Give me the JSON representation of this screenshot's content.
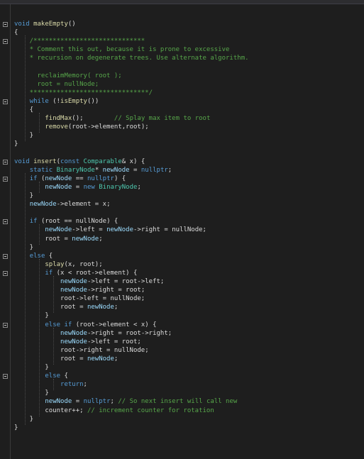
{
  "editor": {
    "lines": [
      [
        {
          "t": "void ",
          "c": "kw"
        },
        {
          "t": "makeEmpty",
          "c": "fn"
        },
        {
          "t": "()",
          "c": ""
        }
      ],
      [
        {
          "t": "{",
          "c": ""
        }
      ],
      [
        {
          "t": "    /*****************************",
          "c": "cm"
        }
      ],
      [
        {
          "t": "    * Comment this out, because it is prone to excessive",
          "c": "cm"
        }
      ],
      [
        {
          "t": "    * recursion on degenerate trees. Use alternate algorithm.",
          "c": "cm"
        }
      ],
      [
        {
          "t": "",
          "c": ""
        }
      ],
      [
        {
          "t": "      reclaimMemory( root );",
          "c": "cm"
        }
      ],
      [
        {
          "t": "      root = nullNode;",
          "c": "cm"
        }
      ],
      [
        {
          "t": "    *******************************/",
          "c": "cm"
        }
      ],
      [
        {
          "t": "    ",
          "c": ""
        },
        {
          "t": "while",
          "c": "kw"
        },
        {
          "t": " (!",
          "c": ""
        },
        {
          "t": "isEmpty",
          "c": "fn"
        },
        {
          "t": "())",
          "c": ""
        }
      ],
      [
        {
          "t": "    {",
          "c": ""
        }
      ],
      [
        {
          "t": "        ",
          "c": ""
        },
        {
          "t": "findMax",
          "c": "fn"
        },
        {
          "t": "();        ",
          "c": ""
        },
        {
          "t": "// Splay max item to root",
          "c": "cm"
        }
      ],
      [
        {
          "t": "        ",
          "c": ""
        },
        {
          "t": "remove",
          "c": "fn"
        },
        {
          "t": "(root->element,root);",
          "c": ""
        }
      ],
      [
        {
          "t": "    }",
          "c": ""
        }
      ],
      [
        {
          "t": "}",
          "c": ""
        }
      ],
      [
        {
          "t": "",
          "c": ""
        }
      ],
      [
        {
          "t": "void ",
          "c": "kw"
        },
        {
          "t": "insert",
          "c": "fn"
        },
        {
          "t": "(",
          "c": ""
        },
        {
          "t": "const ",
          "c": "kw"
        },
        {
          "t": "Comparable",
          "c": "ty"
        },
        {
          "t": "& x) {",
          "c": ""
        }
      ],
      [
        {
          "t": "    ",
          "c": ""
        },
        {
          "t": "static ",
          "c": "kw"
        },
        {
          "t": "BinaryNode",
          "c": "ty"
        },
        {
          "t": "* ",
          "c": ""
        },
        {
          "t": "newNode",
          "c": "var"
        },
        {
          "t": " = ",
          "c": ""
        },
        {
          "t": "nullptr",
          "c": "kw"
        },
        {
          "t": ";",
          "c": ""
        }
      ],
      [
        {
          "t": "    ",
          "c": ""
        },
        {
          "t": "if",
          "c": "kw"
        },
        {
          "t": " (",
          "c": ""
        },
        {
          "t": "newNode",
          "c": "var"
        },
        {
          "t": " == ",
          "c": ""
        },
        {
          "t": "nullptr",
          "c": "kw"
        },
        {
          "t": ") {",
          "c": ""
        }
      ],
      [
        {
          "t": "        ",
          "c": ""
        },
        {
          "t": "newNode",
          "c": "var"
        },
        {
          "t": " = ",
          "c": ""
        },
        {
          "t": "new ",
          "c": "kw"
        },
        {
          "t": "BinaryNode",
          "c": "ty"
        },
        {
          "t": ";",
          "c": ""
        }
      ],
      [
        {
          "t": "    }",
          "c": ""
        }
      ],
      [
        {
          "t": "    ",
          "c": ""
        },
        {
          "t": "newNode",
          "c": "var"
        },
        {
          "t": "->element = x;",
          "c": ""
        }
      ],
      [
        {
          "t": "",
          "c": ""
        }
      ],
      [
        {
          "t": "    ",
          "c": ""
        },
        {
          "t": "if",
          "c": "kw"
        },
        {
          "t": " (root == nullNode) {",
          "c": ""
        }
      ],
      [
        {
          "t": "        ",
          "c": ""
        },
        {
          "t": "newNode",
          "c": "var"
        },
        {
          "t": "->left = ",
          "c": ""
        },
        {
          "t": "newNode",
          "c": "var"
        },
        {
          "t": "->right = nullNode;",
          "c": ""
        }
      ],
      [
        {
          "t": "        root = ",
          "c": ""
        },
        {
          "t": "newNode",
          "c": "var"
        },
        {
          "t": ";",
          "c": ""
        }
      ],
      [
        {
          "t": "    }",
          "c": ""
        }
      ],
      [
        {
          "t": "    ",
          "c": ""
        },
        {
          "t": "else",
          "c": "kw"
        },
        {
          "t": " {",
          "c": ""
        }
      ],
      [
        {
          "t": "        ",
          "c": ""
        },
        {
          "t": "splay",
          "c": "fn"
        },
        {
          "t": "(x, root);",
          "c": ""
        }
      ],
      [
        {
          "t": "        ",
          "c": ""
        },
        {
          "t": "if",
          "c": "kw"
        },
        {
          "t": " (x < root->element) {",
          "c": ""
        }
      ],
      [
        {
          "t": "            ",
          "c": ""
        },
        {
          "t": "newNode",
          "c": "var"
        },
        {
          "t": "->left = root->left;",
          "c": ""
        }
      ],
      [
        {
          "t": "            ",
          "c": ""
        },
        {
          "t": "newNode",
          "c": "var"
        },
        {
          "t": "->right = root;",
          "c": ""
        }
      ],
      [
        {
          "t": "            root->left = nullNode;",
          "c": ""
        }
      ],
      [
        {
          "t": "            root = ",
          "c": ""
        },
        {
          "t": "newNode",
          "c": "var"
        },
        {
          "t": ";",
          "c": ""
        }
      ],
      [
        {
          "t": "        }",
          "c": ""
        }
      ],
      [
        {
          "t": "        ",
          "c": ""
        },
        {
          "t": "else if",
          "c": "kw"
        },
        {
          "t": " (root->element < x) {",
          "c": ""
        }
      ],
      [
        {
          "t": "            ",
          "c": ""
        },
        {
          "t": "newNode",
          "c": "var"
        },
        {
          "t": "->right = root->right;",
          "c": ""
        }
      ],
      [
        {
          "t": "            ",
          "c": ""
        },
        {
          "t": "newNode",
          "c": "var"
        },
        {
          "t": "->left = root;",
          "c": ""
        }
      ],
      [
        {
          "t": "            root->right = nullNode;",
          "c": ""
        }
      ],
      [
        {
          "t": "            root = ",
          "c": ""
        },
        {
          "t": "newNode",
          "c": "var"
        },
        {
          "t": ";",
          "c": ""
        }
      ],
      [
        {
          "t": "        }",
          "c": ""
        }
      ],
      [
        {
          "t": "        ",
          "c": ""
        },
        {
          "t": "else",
          "c": "kw"
        },
        {
          "t": " {",
          "c": ""
        }
      ],
      [
        {
          "t": "            ",
          "c": ""
        },
        {
          "t": "return",
          "c": "kw"
        },
        {
          "t": ";",
          "c": ""
        }
      ],
      [
        {
          "t": "        }",
          "c": ""
        }
      ],
      [
        {
          "t": "        ",
          "c": ""
        },
        {
          "t": "newNode",
          "c": "var"
        },
        {
          "t": " = ",
          "c": ""
        },
        {
          "t": "nullptr",
          "c": "kw"
        },
        {
          "t": "; ",
          "c": ""
        },
        {
          "t": "// So next insert will call new",
          "c": "cm"
        }
      ],
      [
        {
          "t": "        counter++; ",
          "c": ""
        },
        {
          "t": "// increment counter for rotation",
          "c": "cm"
        }
      ],
      [
        {
          "t": "    }",
          "c": ""
        }
      ],
      [
        {
          "t": "}",
          "c": ""
        }
      ]
    ],
    "outline_lines": [
      0,
      2,
      9,
      16,
      18,
      23,
      27,
      29,
      35,
      41
    ]
  },
  "colors": {
    "background": "#1e1e1e",
    "keyword": "#569cd6",
    "type": "#4ec9b0",
    "comment": "#57a64a",
    "function": "#dcdcaa",
    "variable": "#9cdcfe",
    "text": "#dcdcdc"
  }
}
